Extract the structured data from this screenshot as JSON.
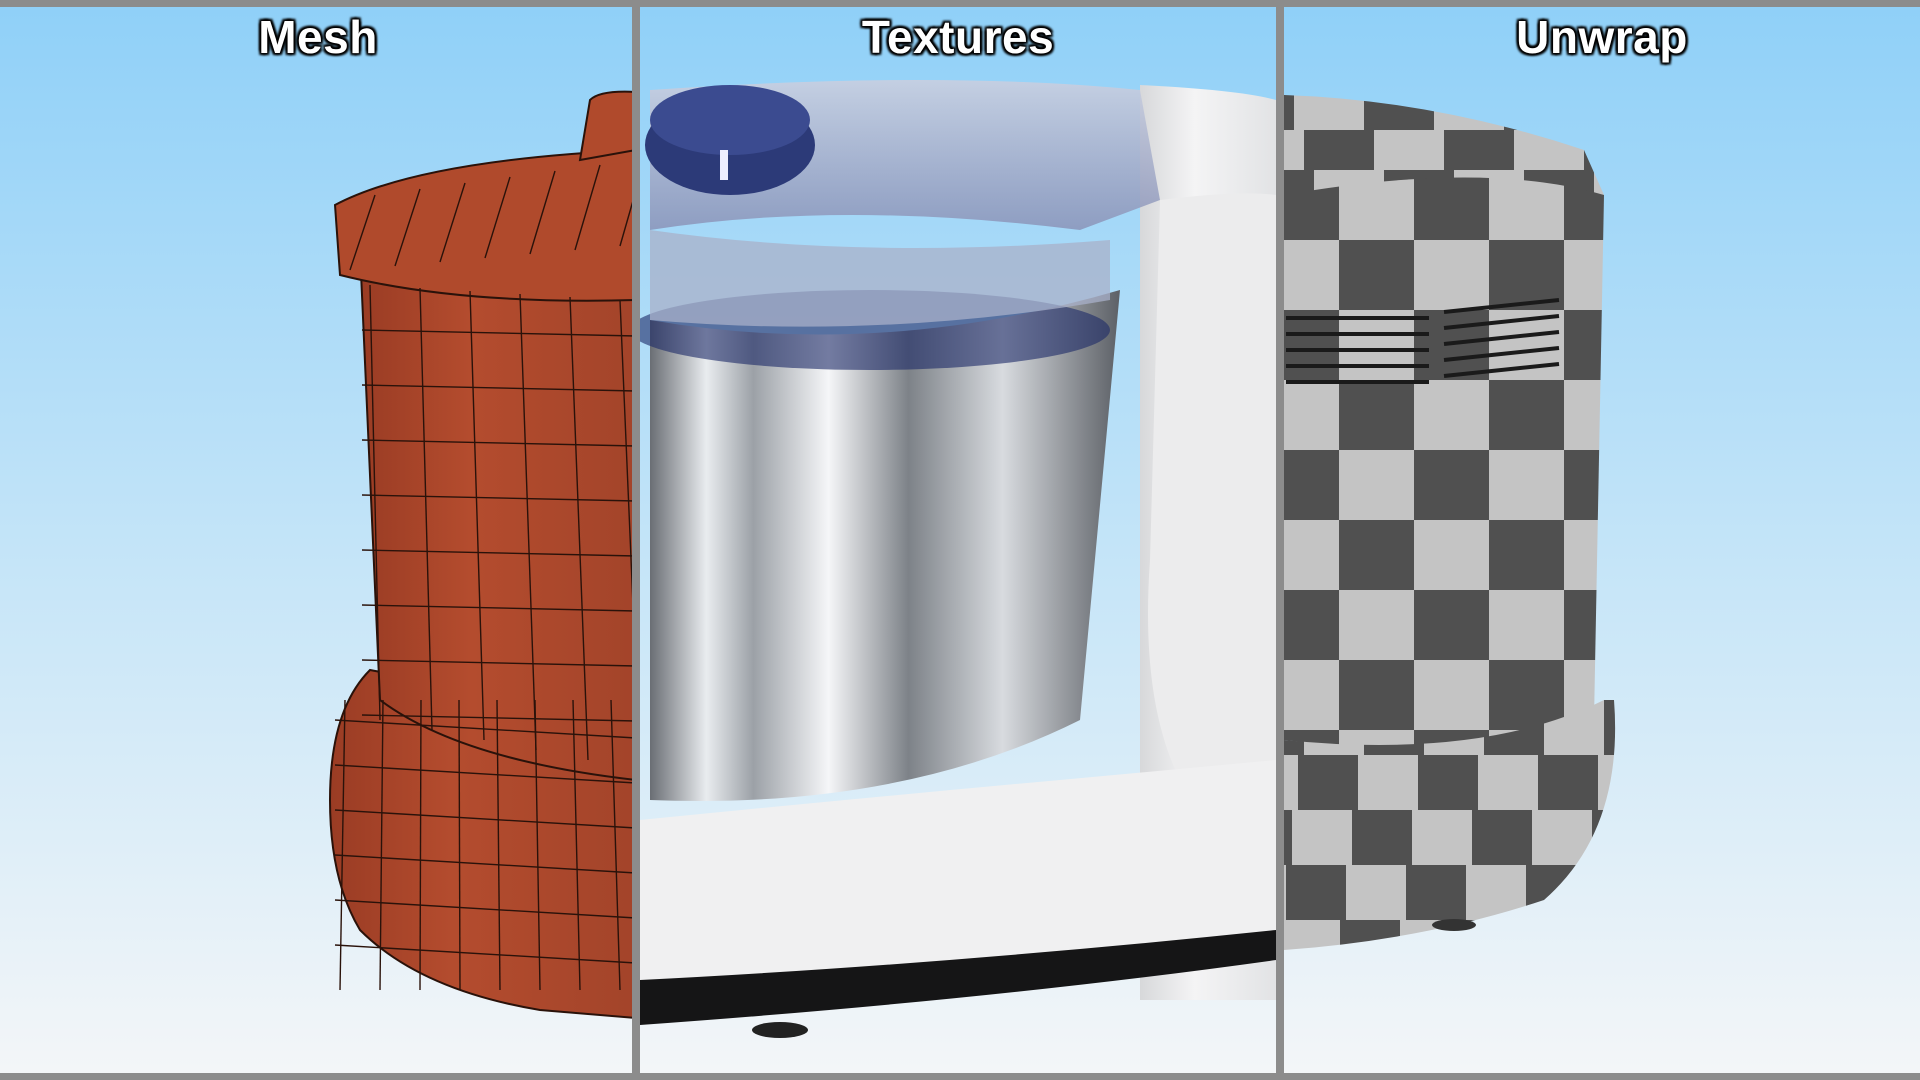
{
  "panels": [
    {
      "id": "mesh",
      "title": "Mesh"
    },
    {
      "id": "textures",
      "title": "Textures"
    },
    {
      "id": "unwrap",
      "title": "Unwrap"
    }
  ],
  "colors": {
    "sky_top": "#8fd0f8",
    "sky_bottom": "#f4f6f8",
    "divider": "#8c8c8c",
    "mesh_fill": "#a8452a",
    "mesh_wire": "#2a120a",
    "steel_light": "#f2f4f6",
    "steel_dark": "#5c6066",
    "lid_blue": "#2c3a78",
    "body_white": "#f1f1f2",
    "base_black": "#151516",
    "check_dark": "#505050",
    "check_light": "#c4c4c4"
  }
}
